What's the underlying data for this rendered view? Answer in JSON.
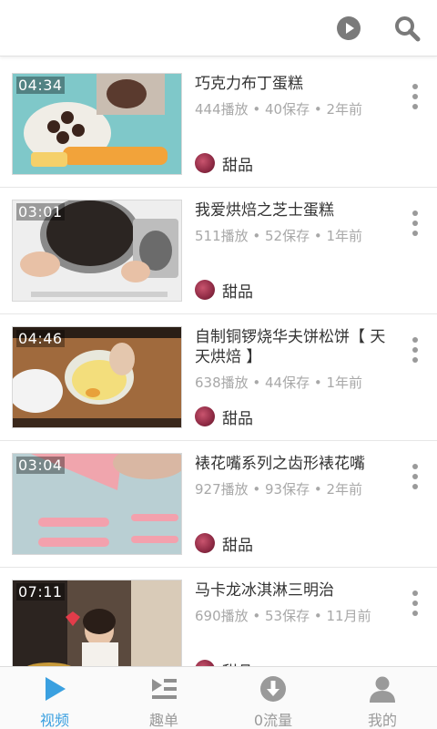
{
  "header": {
    "play_icon": "play-circle-icon",
    "search_icon": "search-icon"
  },
  "items": [
    {
      "duration": "04:34",
      "title": "巧克力布丁蛋糕",
      "meta": "444播放 • 40保存 • 2年前",
      "category": "甜品"
    },
    {
      "duration": "03:01",
      "title": "我爱烘焙之芝士蛋糕",
      "meta": "511播放 • 52保存 • 1年前",
      "category": "甜品"
    },
    {
      "duration": "04:46",
      "title": "自制铜锣烧华夫饼松饼【 天天烘焙 】",
      "meta": "638播放 • 44保存 • 1年前",
      "category": "甜品"
    },
    {
      "duration": "03:04",
      "title": "裱花嘴系列之齿形裱花嘴",
      "meta": "927播放 • 93保存 • 2年前",
      "category": "甜品"
    },
    {
      "duration": "07:11",
      "title": "马卡龙冰淇淋三明治",
      "meta": "690播放 • 53保存 • 11月前",
      "category": "甜品"
    }
  ],
  "tabs": [
    {
      "label": "视频",
      "icon": "video-play-icon",
      "active": true
    },
    {
      "label": "趣单",
      "icon": "playlist-icon",
      "active": false
    },
    {
      "label": "0流量",
      "icon": "download-icon",
      "active": false
    },
    {
      "label": "我的",
      "icon": "user-icon",
      "active": false
    }
  ],
  "colors": {
    "accent": "#3aa0e0",
    "text": "#333333",
    "meta": "#a8a8a8"
  }
}
